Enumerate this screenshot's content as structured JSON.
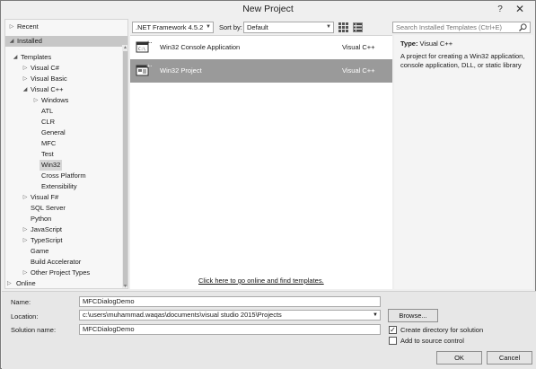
{
  "window": {
    "title": "New Project",
    "help": "?",
    "close": "✕"
  },
  "tree": {
    "recent": "Recent",
    "installed": "Installed",
    "templates": "Templates",
    "items": [
      "Visual C#",
      "Visual Basic",
      "Visual C++",
      "Windows",
      "ATL",
      "CLR",
      "General",
      "MFC",
      "Test",
      "Win32",
      "Cross Platform",
      "Extensibility",
      "Visual F#",
      "SQL Server",
      "Python",
      "JavaScript",
      "TypeScript",
      "Game",
      "Build Accelerator",
      "Other Project Types"
    ],
    "online": "Online"
  },
  "toolbar": {
    "framework": ".NET Framework 4.5.2",
    "sort_label": "Sort by:",
    "sort_value": "Default",
    "search_placeholder": "Search Installed Templates (Ctrl+E)"
  },
  "templates": [
    {
      "name": "Win32 Console Application",
      "lang": "Visual C++",
      "icon": "console-app-icon"
    },
    {
      "name": "Win32 Project",
      "lang": "Visual C++",
      "icon": "win32-project-icon"
    }
  ],
  "online_link": "Click here to go online and find templates.",
  "description": {
    "type_label": "Type:",
    "type_value": "Visual C++",
    "text": "A project for creating a Win32 application, console application, DLL, or static library"
  },
  "form": {
    "name_label": "Name:",
    "name_value": "MFCDialogDemo",
    "location_label": "Location:",
    "location_value": "c:\\users\\muhammad.waqas\\documents\\visual studio 2015\\Projects",
    "solution_label": "Solution name:",
    "solution_value": "MFCDialogDemo",
    "browse": "Browse...",
    "create_dir": "Create directory for solution",
    "create_dir_checked": true,
    "add_source": "Add to source control",
    "add_source_checked": false,
    "ok": "OK",
    "cancel": "Cancel"
  }
}
